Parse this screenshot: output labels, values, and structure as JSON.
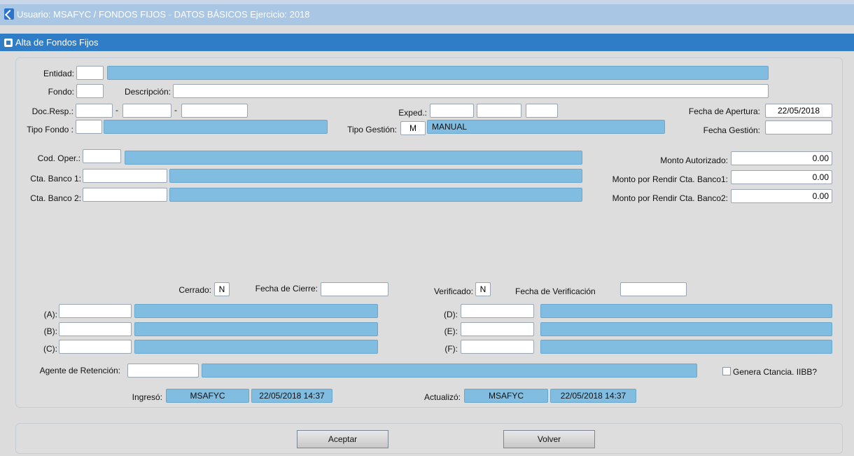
{
  "window": {
    "title": "Usuario: MSAFYC  /  FONDOS FIJOS - DATOS BÁSICOS  Ejercicio: 2018",
    "form_title": "Alta de Fondos Fijos"
  },
  "labels": {
    "entidad": "Entidad:",
    "fondo": "Fondo:",
    "descripcion": "Descripción:",
    "doc_resp": "Doc.Resp.:",
    "dash": "-",
    "exped": "Exped.:",
    "fecha_apertura": "Fecha de Apertura:",
    "tipo_fondo": "Tipo Fondo :",
    "tipo_gestion": "Tipo Gestión:",
    "fecha_gestion": "Fecha Gestión:",
    "cod_oper": "Cod. Oper.:",
    "cta_banco_1": "Cta. Banco 1:",
    "cta_banco_2": "Cta. Banco 2:",
    "monto_autorizado": "Monto Autorizado:",
    "monto_rendir_1": "Monto  por Rendir Cta. Banco1:",
    "monto_rendir_2": "Monto por Rendir Cta. Banco2:",
    "cerrado": "Cerrado:",
    "fecha_cierre": "Fecha de Cierre:",
    "verificado": "Verificado:",
    "fecha_verificacion": "Fecha de Verificación",
    "a": "(A):",
    "b": "(B):",
    "c": "(C):",
    "d": "(D):",
    "e": "(E):",
    "f": "(F):",
    "agente_retencion": "Agente de Retención:",
    "genera_ctancia": "Genera Ctancia. IIBB?",
    "ingreso": "Ingresó:",
    "actualizo": "Actualizó:"
  },
  "values": {
    "entidad": "",
    "fondo": "",
    "descripcion": "",
    "fecha_apertura": "22/05/2018",
    "tipo_gestion_code": "M",
    "tipo_gestion_desc": "MANUAL",
    "fecha_gestion": "",
    "monto_autorizado": "0.00",
    "monto_rendir_1": "0.00",
    "monto_rendir_2": "0.00",
    "cerrado": "N",
    "verificado": "N",
    "genera_ctancia_checked": false,
    "ingreso_user": "MSAFYC",
    "ingreso_date": "22/05/2018 14:37",
    "actualizo_user": "MSAFYC",
    "actualizo_date": "22/05/2018 14:37"
  },
  "buttons": {
    "aceptar": "Aceptar",
    "volver": "Volver"
  },
  "colors": {
    "title_bar": "#a9c6e4",
    "form_bar": "#2e7dc6",
    "lookup_field": "#80bde0",
    "background": "#dcdcdc"
  },
  "icons": {
    "window": "app-window-icon",
    "form": "form-icon",
    "checkbox": "checkbox-icon"
  }
}
